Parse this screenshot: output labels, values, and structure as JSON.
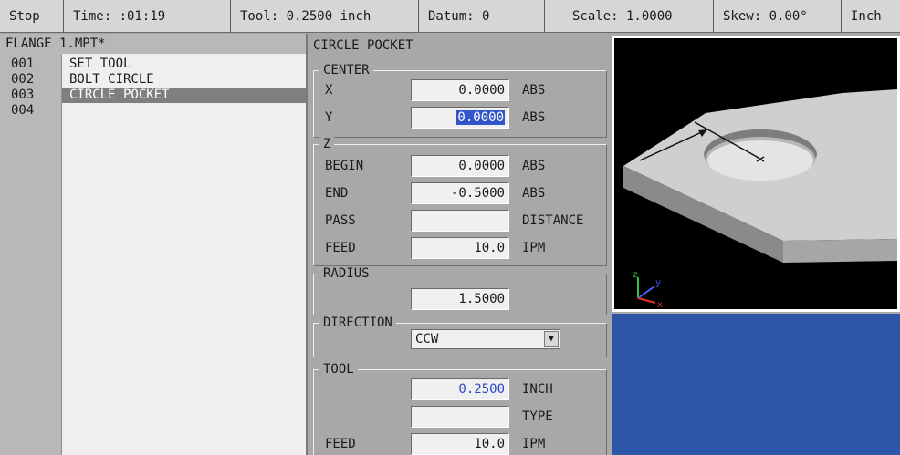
{
  "status_bar": {
    "mode": "Stop",
    "time": "Time: :01:19",
    "tool": "Tool: 0.2500  inch",
    "datum": "Datum: 0",
    "scale": "Scale: 1.0000",
    "skew": "Skew: 0.00°",
    "units": "Inch"
  },
  "program": {
    "title": "FLANGE 1.MPT*",
    "steps": [
      {
        "num": "001",
        "label": "SET TOOL"
      },
      {
        "num": "002",
        "label": "BOLT CIRCLE"
      },
      {
        "num": "003",
        "label": "CIRCLE POCKET"
      },
      {
        "num": "004",
        "label": ""
      }
    ],
    "selected_step": "003"
  },
  "form": {
    "title": "CIRCLE POCKET",
    "center": {
      "legend": "CENTER",
      "x_label": "X",
      "x_value": "0.0000",
      "x_unit": "ABS",
      "y_label": "Y",
      "y_value": "0.0000",
      "y_unit": "ABS"
    },
    "z": {
      "legend": "Z",
      "begin_label": "BEGIN",
      "begin_value": "0.0000",
      "begin_unit": "ABS",
      "end_label": "END",
      "end_value": "-0.5000",
      "end_unit": "ABS",
      "pass_label": "PASS",
      "pass_value": "",
      "pass_unit": "DISTANCE",
      "feed_label": "FEED",
      "feed_value": "10.0",
      "feed_unit": "IPM"
    },
    "radius": {
      "legend": "RADIUS",
      "value": "1.5000"
    },
    "direction": {
      "legend": "DIRECTION",
      "value": "CCW"
    },
    "tool": {
      "legend": "TOOL",
      "size_value": "0.2500",
      "size_unit": "INCH",
      "type_value": "",
      "type_unit": "TYPE",
      "feed_label": "FEED",
      "feed_value": "10.0",
      "feed_unit": "IPM"
    }
  },
  "view3d": {
    "axis_x": "x",
    "axis_y": "y",
    "axis_z": "z",
    "axis_colors": {
      "x": "#e23030",
      "y": "#4a5bff",
      "z": "#28c840"
    },
    "background": "#000000"
  },
  "colors": {
    "highlight": "#3355cc",
    "value_blue": "#2b46c8",
    "lower_panel": "#2d55a8"
  }
}
